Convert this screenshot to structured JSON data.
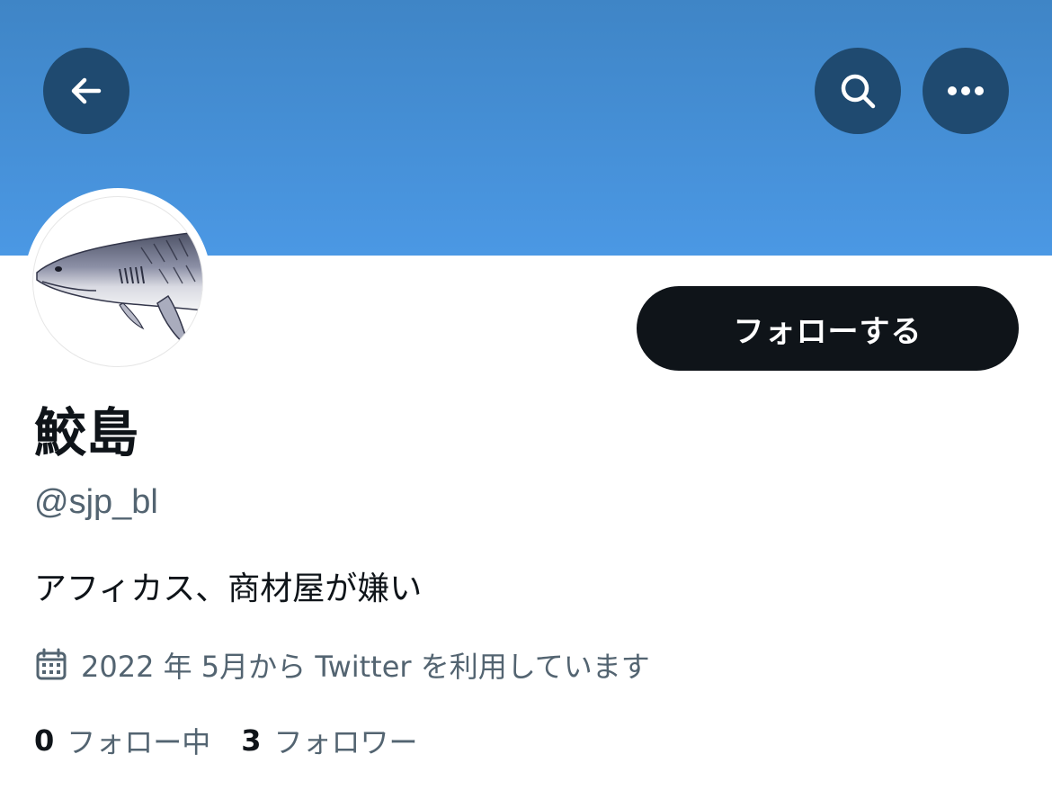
{
  "header": {
    "back_icon": "arrow-left-icon",
    "search_icon": "search-icon",
    "more_icon": "more-horizontal-icon",
    "banner_color": "#4b98e4",
    "button_bg": "#1f4a70"
  },
  "profile": {
    "avatar_icon": "shark-avatar",
    "display_name": "鮫島",
    "handle": "@sjp_bl",
    "bio": "アフィカス、商材屋が嫌い",
    "joined_icon": "calendar-icon",
    "joined_text": "2022 年 5月から Twitter を利用しています",
    "follow_button_label": "フォローする"
  },
  "stats": {
    "following_count": "0",
    "following_label": "フォロー中",
    "followers_count": "3",
    "followers_label": "フォロワー"
  },
  "colors": {
    "primary_text": "#0f1419",
    "secondary_text": "#536471",
    "follow_button_bg": "#0f1419"
  }
}
